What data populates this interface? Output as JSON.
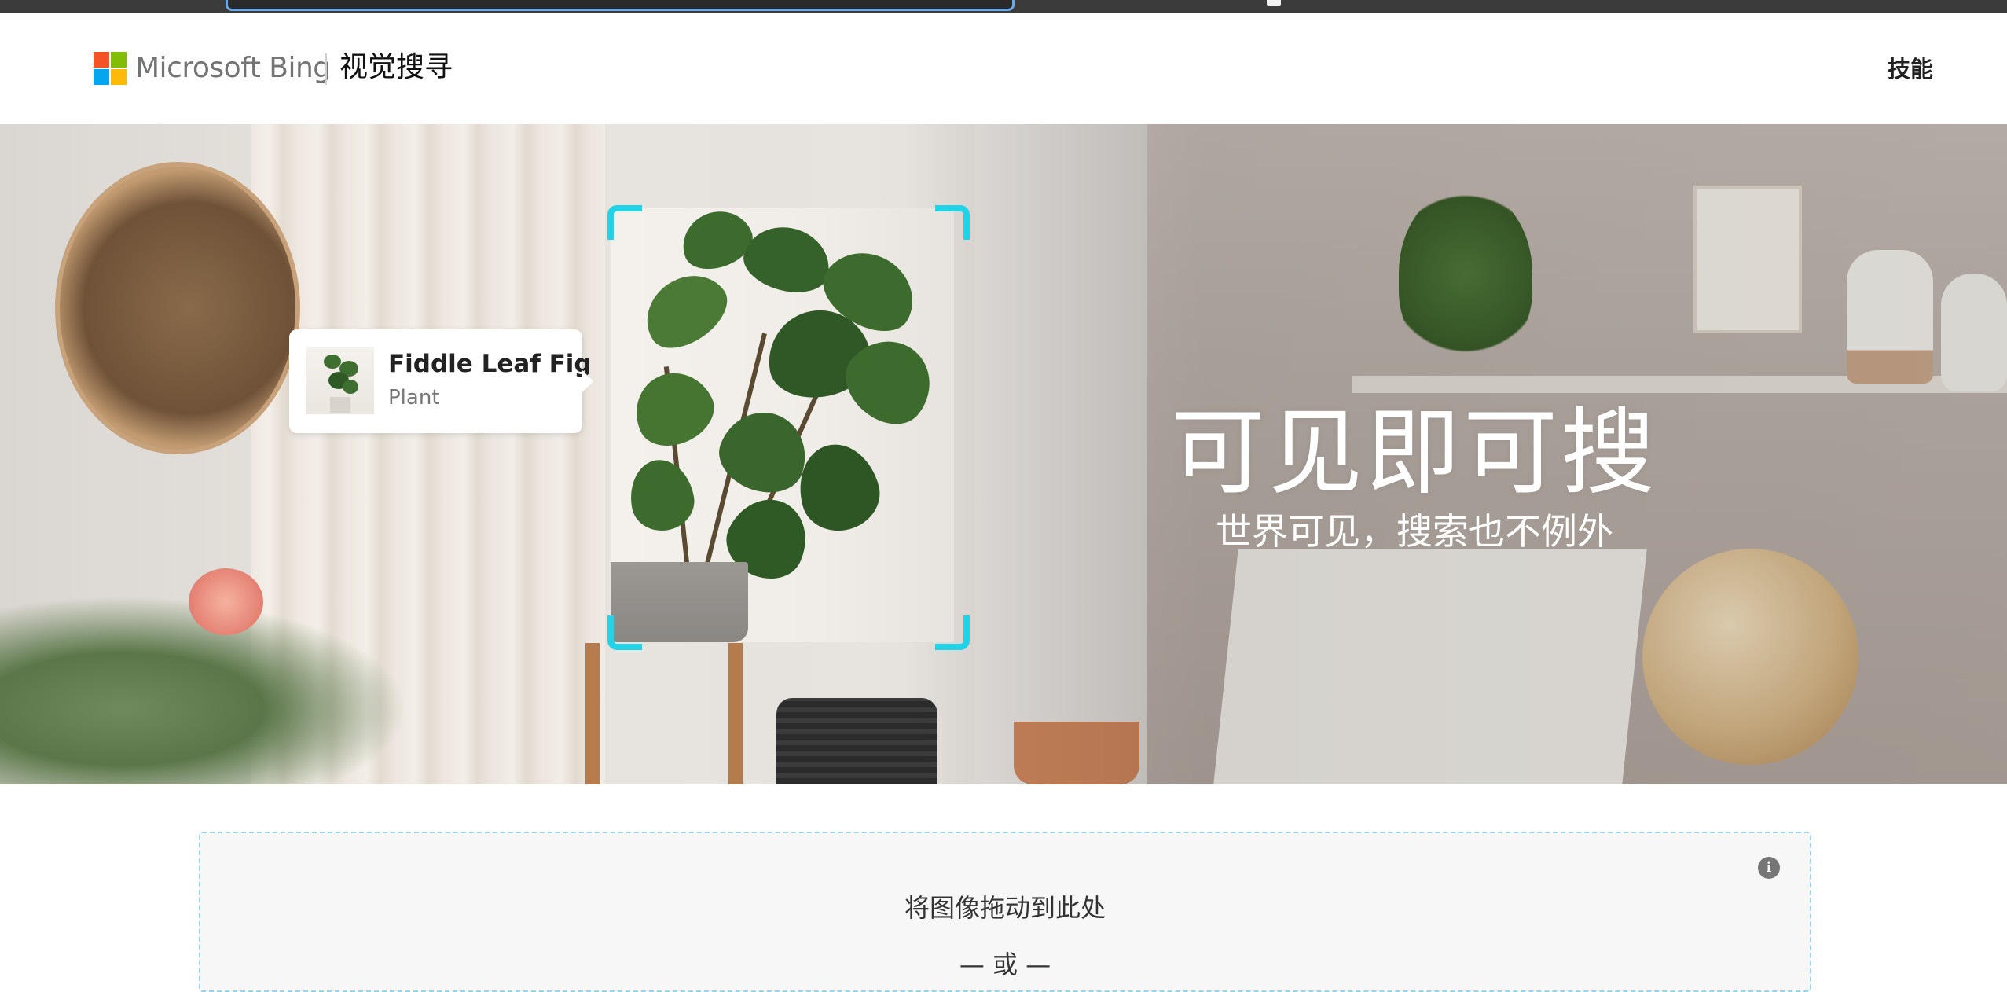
{
  "header": {
    "brand": "Microsoft Bing",
    "product": "视觉搜寻",
    "nav_skills": "技能",
    "logo_colors": [
      "#f35325",
      "#81bc06",
      "#05a6f0",
      "#ffba08"
    ]
  },
  "hero": {
    "result_card": {
      "title": "Fiddle Leaf Fig",
      "subtitle": "Plant"
    },
    "headline": "可见即可搜",
    "subheadline": "世界可见，搜索也不例外",
    "selection_color": "#22d3e8"
  },
  "drop_zone": {
    "drop_text": "将图像拖动到此处",
    "or_text": "— 或 —",
    "info_icon": "info-icon",
    "border_color": "#9bd4e6"
  }
}
